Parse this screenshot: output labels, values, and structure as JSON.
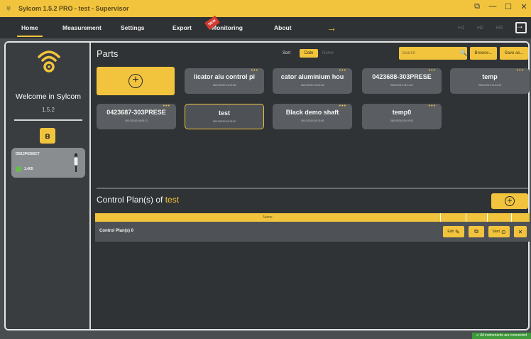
{
  "window": {
    "title": "Sylcom 1.5.2 PRO - test - Supervisor",
    "controls": [
      "⧉",
      "—",
      "☐",
      "✕"
    ]
  },
  "menu": {
    "items": [
      "Home",
      "Measurement",
      "Settings",
      "Export",
      "Monitoring",
      "About"
    ],
    "active": "Home",
    "new_badge": "NEW",
    "arrow": "→",
    "right_items": [
      "H1",
      "H2",
      "H3"
    ]
  },
  "sidebar": {
    "welcome": "Welcome in Sylcom",
    "version": "1.5.2",
    "bluetooth_icon": "bluetooth-icon",
    "device": {
      "name": "DB13P6300C7",
      "value": "1.405",
      "status_color": "#62c04a"
    }
  },
  "parts": {
    "title": "Parts",
    "sort_label": "Sort",
    "sort_date": "Date",
    "sort_name": "Name",
    "search_placeholder": "Search",
    "browse_label": "Browse...",
    "save_label": "Save as...",
    "add_icon": "plus-circle-icon",
    "tiles": [
      {
        "name": "licator alu control pi",
        "date": "08/10/2019 16:10:38"
      },
      {
        "name": "cator aluminium hou",
        "date": "08/10/2019 16:09:48"
      },
      {
        "name": "0423688-303PRESE",
        "date": "08/10/2019 16:11:20"
      },
      {
        "name": "temp",
        "date": "08/10/2019 11:04:40"
      },
      {
        "name": "0423687-303PRESE",
        "date": "08/10/2019 16:05:12"
      },
      {
        "name": "test",
        "date": "08/10/2019 09:13:20"
      },
      {
        "name": "Black demo shaft",
        "date": "08/10/2019 09:13:48"
      },
      {
        "name": "temp0",
        "date": "08/10/2019 09:10:02"
      }
    ],
    "selected": "test"
  },
  "control_plans": {
    "title_prefix": "Control Plan(s) of",
    "part": "test",
    "column_name": "Name",
    "row_label": "Control Plan(s) 0",
    "edit_label": "Edit",
    "start_label": "Start",
    "delete_label": "✕"
  },
  "status_bar": "All instruments are connected",
  "colors": {
    "accent": "#f2c43d",
    "background": "#303335",
    "tile": "#5a5e62",
    "ok": "#3e9a3a"
  }
}
